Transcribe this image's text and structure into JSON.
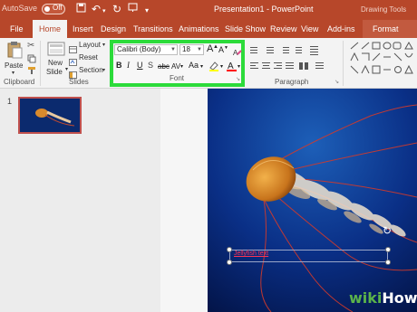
{
  "titlebar": {
    "autosave_label": "AutoSave",
    "autosave_state": "Off",
    "doc_title": "Presentation1  -  PowerPoint",
    "context_tools": "Drawing Tools"
  },
  "tabs": [
    "File",
    "Home",
    "Insert",
    "Design",
    "Transitions",
    "Animations",
    "Slide Show",
    "Review",
    "View",
    "Add-ins",
    "Format"
  ],
  "ribbon": {
    "clipboard": {
      "paste": "Paste",
      "label": "Clipboard"
    },
    "slides": {
      "new_slide_1": "New",
      "new_slide_2": "Slide",
      "layout": "Layout",
      "reset": "Reset",
      "section": "Section",
      "label": "Slides"
    },
    "font": {
      "family": "Calibri (Body)",
      "size": "18",
      "grow": "A",
      "shrink": "A",
      "bold": "B",
      "italic": "I",
      "underline": "U",
      "shadow": "S",
      "strike": "abc",
      "spacing": "AV",
      "case": "Aa",
      "label": "Font"
    },
    "paragraph": {
      "label": "Paragraph"
    }
  },
  "slides_pane": {
    "slide_number": "1"
  },
  "slide": {
    "textbox_text": "Jellyfish text"
  },
  "colors": {
    "accent": "#b7472a",
    "highlight_box": "#2cdb3a"
  },
  "watermark": {
    "wiki": "wiki",
    "how": "How"
  }
}
